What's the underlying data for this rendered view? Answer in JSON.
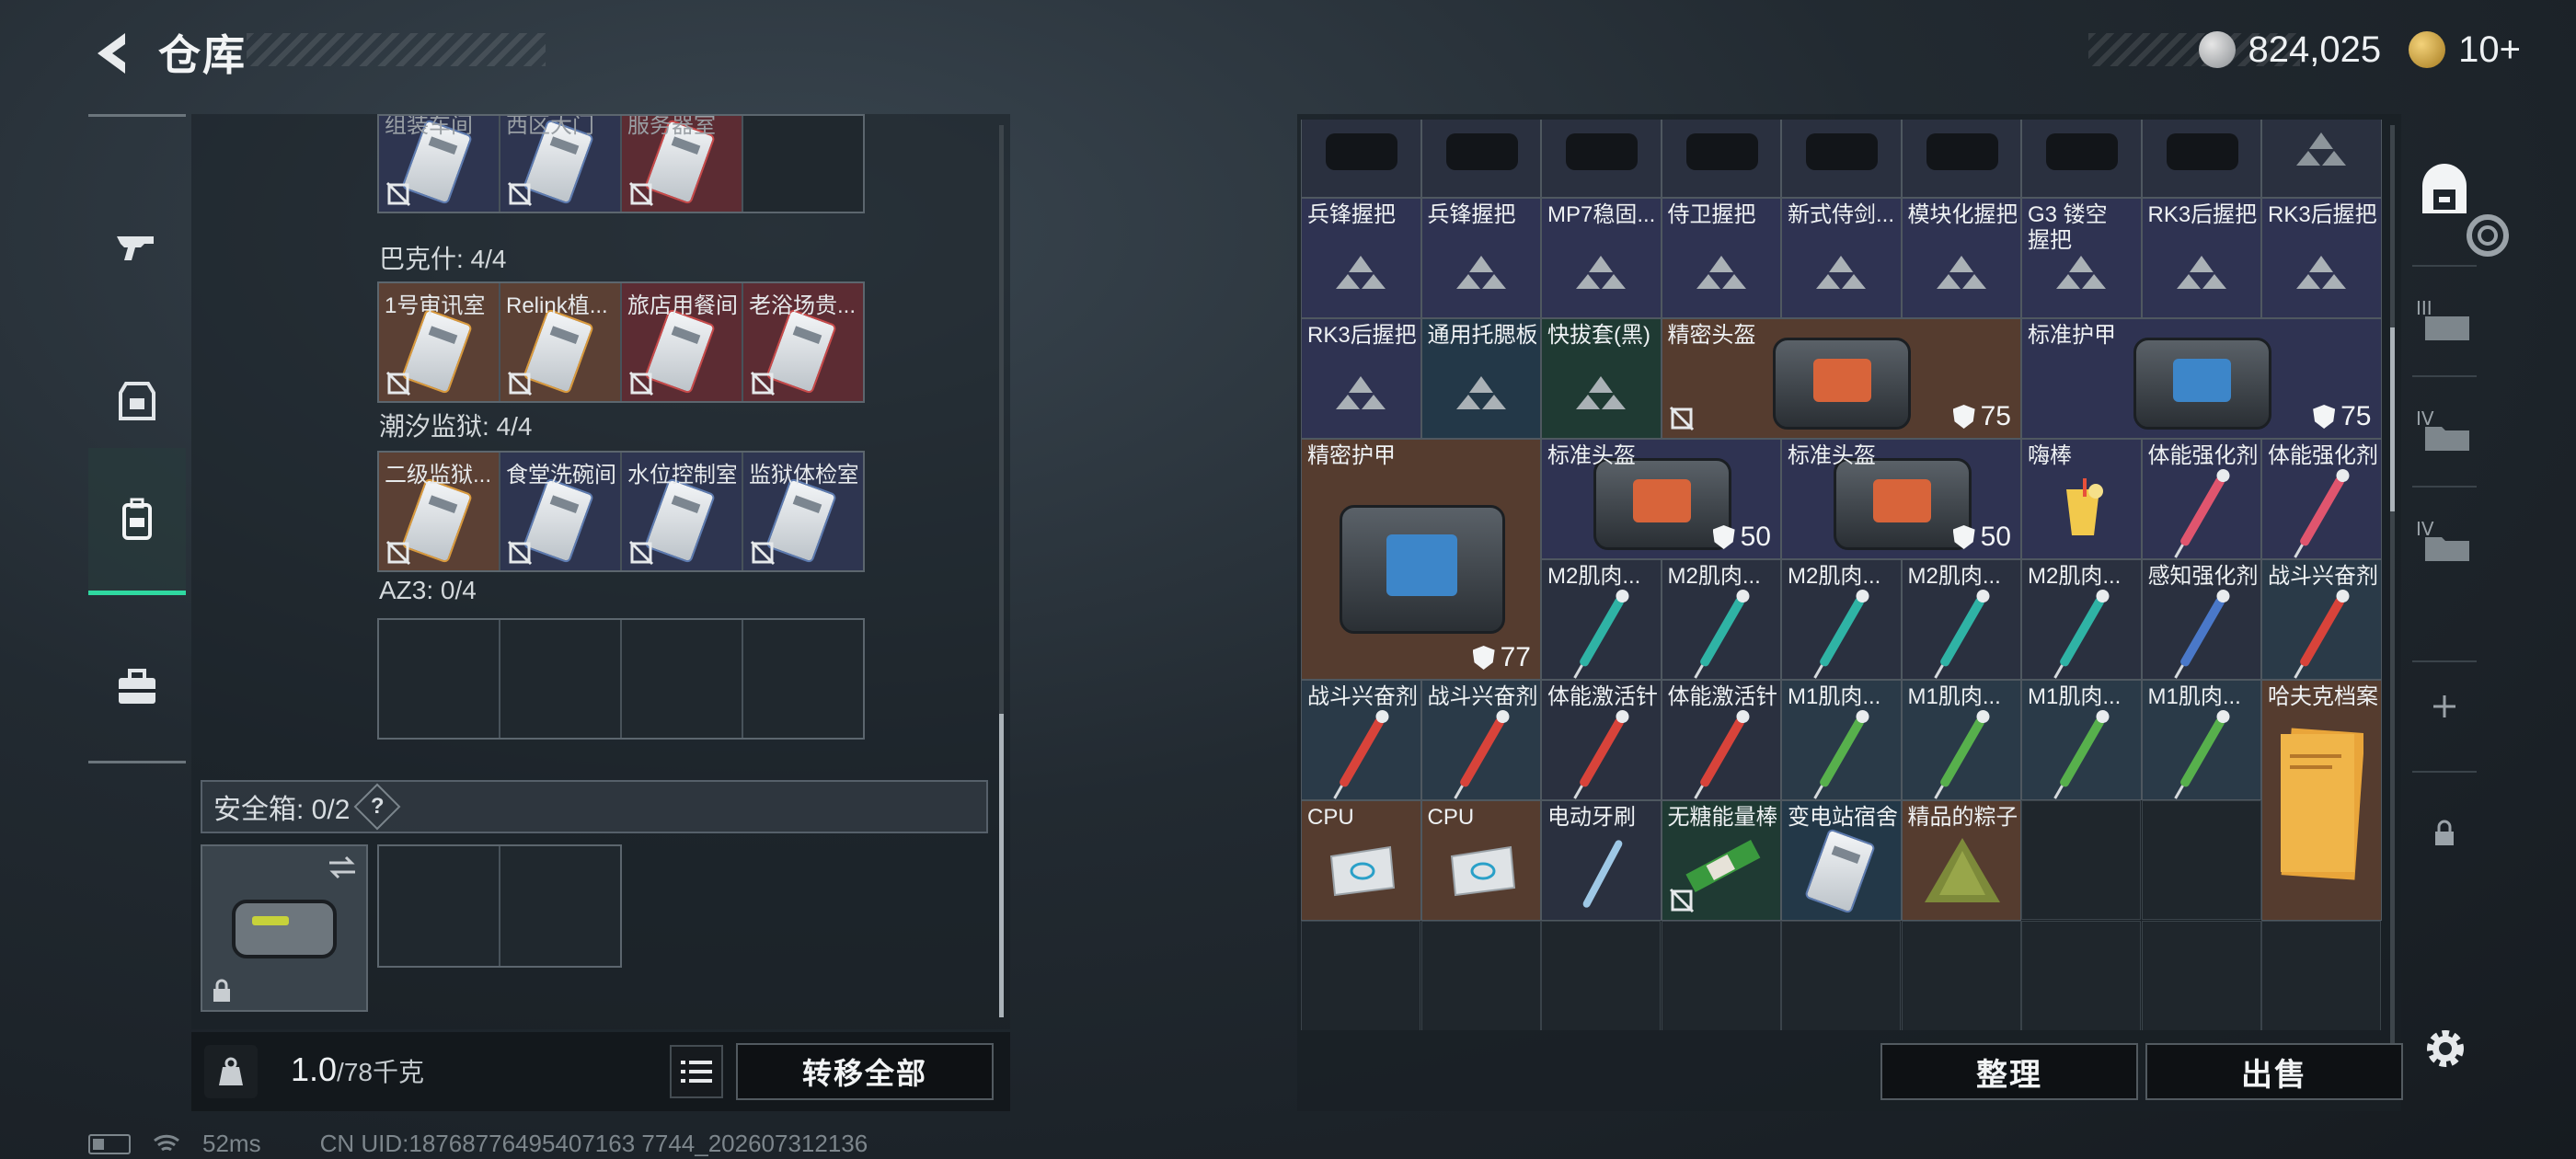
{
  "header": {
    "title": "仓库",
    "back_icon": "back-arrow-icon"
  },
  "currency": {
    "silver_amount": "824,025",
    "gold_amount": "10+",
    "silver_icon": "silver-coin-icon",
    "gold_icon": "gold-coin-icon"
  },
  "left_nav": [
    {
      "icon": "gun-icon",
      "active": false
    },
    {
      "icon": "armor-icon",
      "active": false
    },
    {
      "icon": "backpack-icon",
      "active": true
    },
    {
      "icon": "toolbox-icon",
      "active": false
    }
  ],
  "key_sections": [
    {
      "label": "",
      "rows": [
        [
          {
            "name": "组装车间",
            "type": "blue",
            "faded": true
          },
          {
            "name": "西区大门",
            "type": "blue",
            "faded": true
          },
          {
            "name": "服务器室",
            "type": "red",
            "faded": true
          },
          {
            "name": "",
            "type": "empty"
          }
        ]
      ]
    },
    {
      "label": "巴克什: 4/4",
      "rows": [
        [
          {
            "name": "1号审讯室",
            "type": "brown",
            "faded": false
          },
          {
            "name": "Relink植...",
            "type": "brown",
            "faded": false
          },
          {
            "name": "旅店用餐间",
            "type": "red",
            "faded": false
          },
          {
            "name": "老浴场贵...",
            "type": "red",
            "faded": false
          }
        ]
      ]
    },
    {
      "label": "潮汐监狱: 4/4",
      "rows": [
        [
          {
            "name": "二级监狱...",
            "type": "brown",
            "faded": false
          },
          {
            "name": "食堂洗碗间",
            "type": "blue",
            "faded": false
          },
          {
            "name": "水位控制室",
            "type": "blue",
            "faded": false
          },
          {
            "name": "监狱体检室",
            "type": "blue",
            "faded": false
          }
        ]
      ]
    },
    {
      "label": "AZ3: 0/4",
      "rows": [
        [
          {
            "name": "",
            "type": "empty"
          },
          {
            "name": "",
            "type": "empty"
          },
          {
            "name": "",
            "type": "empty"
          },
          {
            "name": "",
            "type": "empty"
          }
        ]
      ]
    }
  ],
  "safe": {
    "label": "安全箱: 0/2",
    "help": "?"
  },
  "bottom_left": {
    "weight_value": "1.0",
    "weight_max": "/78千克",
    "transfer_all": "转移全部"
  },
  "status_bar": {
    "ping": "52ms",
    "uid": "CN UID:18768776495407163 7744_202607312136"
  },
  "right_buttons": {
    "organize": "整理",
    "sell": "出售"
  },
  "stash_items": [
    {
      "name": "兵锋握把",
      "col": 0,
      "row": 1,
      "w": 1,
      "h": 1,
      "tier": "blue",
      "kind": "attach"
    },
    {
      "name": "兵锋握把",
      "col": 1,
      "row": 1,
      "w": 1,
      "h": 1,
      "tier": "blue",
      "kind": "attach"
    },
    {
      "name": "MP7稳固...",
      "col": 2,
      "row": 1,
      "w": 1,
      "h": 1,
      "tier": "blue",
      "kind": "attach"
    },
    {
      "name": "侍卫握把",
      "col": 3,
      "row": 1,
      "w": 1,
      "h": 1,
      "tier": "blue",
      "kind": "attach"
    },
    {
      "name": "新式侍剑...",
      "col": 4,
      "row": 1,
      "w": 1,
      "h": 1,
      "tier": "blue",
      "kind": "attach"
    },
    {
      "name": "模块化握把",
      "col": 5,
      "row": 1,
      "w": 1,
      "h": 1,
      "tier": "blue",
      "kind": "attach"
    },
    {
      "name": "G3 镂空握把",
      "col": 6,
      "row": 1,
      "w": 1,
      "h": 1,
      "tier": "blue",
      "kind": "attach"
    },
    {
      "name": "RK3后握把",
      "col": 7,
      "row": 1,
      "w": 1,
      "h": 1,
      "tier": "blue",
      "kind": "attach"
    },
    {
      "name": "RK3后握把",
      "col": 8,
      "row": 1,
      "w": 1,
      "h": 1,
      "tier": "blue",
      "kind": "attach"
    },
    {
      "name": "RK3后握把",
      "col": 0,
      "row": 2,
      "w": 1,
      "h": 1,
      "tier": "blue",
      "kind": "attach"
    },
    {
      "name": "通用托腮板",
      "col": 1,
      "row": 2,
      "w": 1,
      "h": 1,
      "tier": "teal",
      "kind": "attach"
    },
    {
      "name": "快拔套(黑)",
      "col": 2,
      "row": 2,
      "w": 1,
      "h": 1,
      "tier": "green",
      "kind": "attach"
    },
    {
      "name": "精密头盔",
      "col": 3,
      "row": 2,
      "w": 3,
      "h": 1,
      "tier": "brown",
      "kind": "helmet-orange",
      "durability": "75",
      "locked": true
    },
    {
      "name": "标准护甲",
      "col": 6,
      "row": 2,
      "w": 3,
      "h": 1,
      "tier": "blue",
      "kind": "armor-blue",
      "durability": "75"
    },
    {
      "name": "精密护甲",
      "col": 0,
      "row": 3,
      "w": 2,
      "h": 2,
      "tier": "brown",
      "kind": "armor-blue",
      "durability": "77"
    },
    {
      "name": "标准头盔",
      "col": 2,
      "row": 3,
      "w": 2,
      "h": 1,
      "tier": "blue",
      "kind": "helmet-orange",
      "durability": "50"
    },
    {
      "name": "标准头盔",
      "col": 4,
      "row": 3,
      "w": 2,
      "h": 1,
      "tier": "blue",
      "kind": "helmet-orange",
      "durability": "50"
    },
    {
      "name": "嗨棒",
      "col": 6,
      "row": 3,
      "w": 1,
      "h": 1,
      "tier": "blue",
      "kind": "drink"
    },
    {
      "name": "体能强化剂",
      "col": 7,
      "row": 3,
      "w": 1,
      "h": 1,
      "tier": "blue",
      "kind": "syr-pink"
    },
    {
      "name": "体能强化剂",
      "col": 8,
      "row": 3,
      "w": 1,
      "h": 1,
      "tier": "blue",
      "kind": "syr-pink"
    },
    {
      "name": "M2肌肉...",
      "col": 2,
      "row": 4,
      "w": 1,
      "h": 1,
      "tier": "dark",
      "kind": "syr-teal"
    },
    {
      "name": "M2肌肉...",
      "col": 3,
      "row": 4,
      "w": 1,
      "h": 1,
      "tier": "dark",
      "kind": "syr-teal"
    },
    {
      "name": "M2肌肉...",
      "col": 4,
      "row": 4,
      "w": 1,
      "h": 1,
      "tier": "dark",
      "kind": "syr-teal"
    },
    {
      "name": "M2肌肉...",
      "col": 5,
      "row": 4,
      "w": 1,
      "h": 1,
      "tier": "dark",
      "kind": "syr-teal"
    },
    {
      "name": "M2肌肉...",
      "col": 6,
      "row": 4,
      "w": 1,
      "h": 1,
      "tier": "dark",
      "kind": "syr-teal"
    },
    {
      "name": "感知强化剂",
      "col": 7,
      "row": 4,
      "w": 1,
      "h": 1,
      "tier": "dark",
      "kind": "syr-blue"
    },
    {
      "name": "战斗兴奋剂",
      "col": 8,
      "row": 4,
      "w": 1,
      "h": 1,
      "tier": "steel",
      "kind": "syr-red"
    },
    {
      "name": "战斗兴奋剂",
      "col": 0,
      "row": 5,
      "w": 1,
      "h": 1,
      "tier": "steel",
      "kind": "syr-red"
    },
    {
      "name": "战斗兴奋剂",
      "col": 1,
      "row": 5,
      "w": 1,
      "h": 1,
      "tier": "steel",
      "kind": "syr-red"
    },
    {
      "name": "体能激活针",
      "col": 2,
      "row": 5,
      "w": 1,
      "h": 1,
      "tier": "dark",
      "kind": "syr-red"
    },
    {
      "name": "体能激活针",
      "col": 3,
      "row": 5,
      "w": 1,
      "h": 1,
      "tier": "dark",
      "kind": "syr-red"
    },
    {
      "name": "M1肌肉...",
      "col": 4,
      "row": 5,
      "w": 1,
      "h": 1,
      "tier": "steel",
      "kind": "syr-green"
    },
    {
      "name": "M1肌肉...",
      "col": 5,
      "row": 5,
      "w": 1,
      "h": 1,
      "tier": "steel",
      "kind": "syr-green"
    },
    {
      "name": "M1肌肉...",
      "col": 6,
      "row": 5,
      "w": 1,
      "h": 1,
      "tier": "steel",
      "kind": "syr-green"
    },
    {
      "name": "M1肌肉...",
      "col": 7,
      "row": 5,
      "w": 1,
      "h": 1,
      "tier": "steel",
      "kind": "syr-green"
    },
    {
      "name": "哈夫克档案",
      "col": 8,
      "row": 5,
      "w": 1,
      "h": 2,
      "tier": "brown",
      "kind": "folder"
    },
    {
      "name": "CPU",
      "col": 0,
      "row": 6,
      "w": 1,
      "h": 1,
      "tier": "brown",
      "kind": "cpu"
    },
    {
      "name": "CPU",
      "col": 1,
      "row": 6,
      "w": 1,
      "h": 1,
      "tier": "brown",
      "kind": "cpu"
    },
    {
      "name": "电动牙刷",
      "col": 2,
      "row": 6,
      "w": 1,
      "h": 1,
      "tier": "dark",
      "kind": "brush"
    },
    {
      "name": "无糖能量棒",
      "col": 3,
      "row": 6,
      "w": 1,
      "h": 1,
      "tier": "green",
      "kind": "bar",
      "locked": true
    },
    {
      "name": "变电站宿舍",
      "col": 4,
      "row": 6,
      "w": 1,
      "h": 1,
      "tier": "teal",
      "kind": "keycard"
    },
    {
      "name": "精品的粽子",
      "col": 5,
      "row": 6,
      "w": 1,
      "h": 1,
      "tier": "brown",
      "kind": "zongzi"
    }
  ],
  "top_partial_row": [
    "scope",
    "scope",
    "scope",
    "scope",
    "scope",
    "scope",
    "scope",
    "scope",
    "attach"
  ],
  "right_sidebar": [
    {
      "icon": "vault-icon",
      "label": ""
    },
    {
      "icon": "tier3-case-icon",
      "label": "III"
    },
    {
      "icon": "tier4-folder-icon",
      "label": "IV"
    },
    {
      "icon": "tier4-folder-icon",
      "label": "IV"
    },
    {
      "icon": "plus-icon",
      "label": "+"
    },
    {
      "icon": "lock-icon",
      "label": ""
    }
  ],
  "colors": {
    "accent": "#2fd8a0",
    "brown_tier": "#553c2f",
    "blue_tier": "#2f3352",
    "red_tier": "#5c2c33"
  }
}
